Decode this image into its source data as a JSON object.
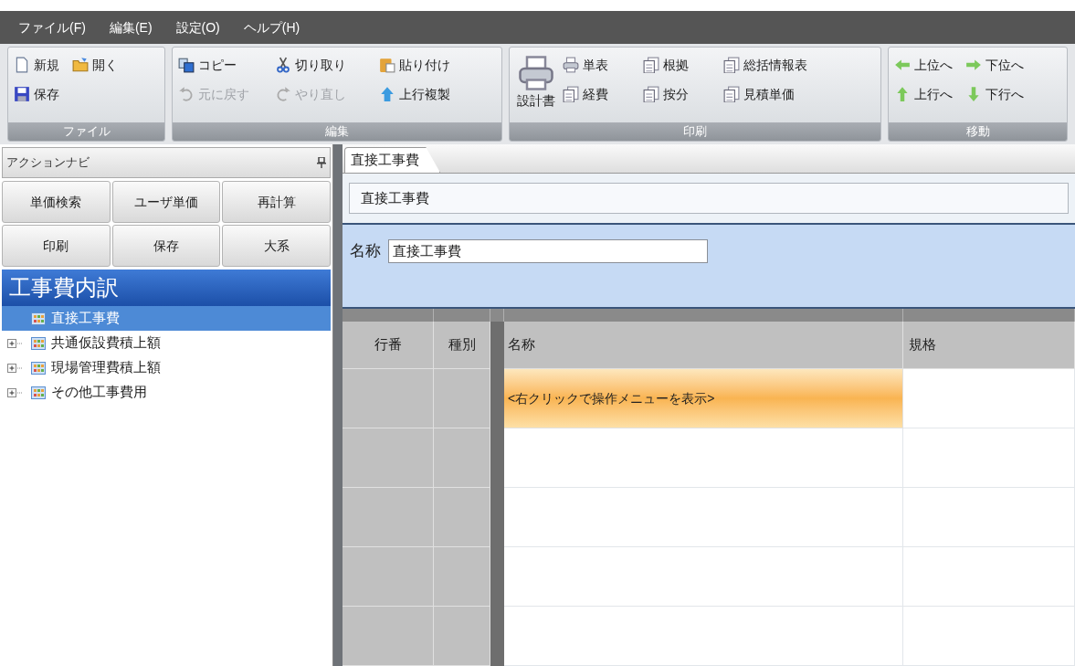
{
  "menu": [
    {
      "label": "ファイル(F)"
    },
    {
      "label": "編集(E)"
    },
    {
      "label": "設定(O)"
    },
    {
      "label": "ヘルプ(H)"
    }
  ],
  "ribbon": {
    "groups": [
      {
        "label": "ファイル",
        "rows": [
          [
            {
              "label": "新規",
              "disabled": false
            },
            {
              "label": "開く",
              "disabled": false
            }
          ],
          [
            {
              "label": "保存",
              "disabled": false
            }
          ]
        ]
      },
      {
        "label": "編集",
        "rows": [
          [
            {
              "label": "コピー",
              "disabled": false
            },
            {
              "label": "切り取り",
              "disabled": false
            },
            {
              "label": "貼り付け",
              "disabled": false
            }
          ],
          [
            {
              "label": "元に戻す",
              "disabled": true
            },
            {
              "label": "やり直し",
              "disabled": true
            },
            {
              "label": "上行複製",
              "disabled": false
            }
          ]
        ]
      },
      {
        "label": "印刷",
        "large_button": {
          "label": "設計書"
        },
        "rows": [
          [
            {
              "label": "単表",
              "disabled": false
            },
            {
              "label": "根拠",
              "disabled": false
            },
            {
              "label": "総括情報表",
              "disabled": false
            }
          ],
          [
            {
              "label": "経費",
              "disabled": false
            },
            {
              "label": "按分",
              "disabled": false
            },
            {
              "label": "見積単価",
              "disabled": false
            }
          ]
        ]
      },
      {
        "label": "移動",
        "rows": [
          [
            {
              "label": "上位へ",
              "disabled": false
            },
            {
              "label": "下位へ",
              "disabled": false
            }
          ],
          [
            {
              "label": "上行へ",
              "disabled": false
            },
            {
              "label": "下行へ",
              "disabled": false
            }
          ]
        ]
      }
    ]
  },
  "navi": {
    "title": "アクションナビ",
    "buttons": [
      {
        "label": "単価検索"
      },
      {
        "label": "ユーザ単価"
      },
      {
        "label": "再計算"
      },
      {
        "label": "印刷"
      },
      {
        "label": "保存"
      },
      {
        "label": "大系"
      }
    ],
    "tree_title": "工事費内訳",
    "tree": [
      {
        "label": "直接工事費",
        "kind": "leaf",
        "selected": true
      },
      {
        "label": "共通仮設費積上額",
        "kind": "collapsed",
        "selected": false
      },
      {
        "label": "現場管理費積上額",
        "kind": "collapsed",
        "selected": false
      },
      {
        "label": "その他工事費用",
        "kind": "collapsed",
        "selected": false
      }
    ]
  },
  "tabs": [
    {
      "label": "直接工事費",
      "selected": true
    }
  ],
  "path": "直接工事費",
  "name_field": {
    "label": "名称",
    "value": "直接工事費"
  },
  "grid": {
    "columns": [
      "行番",
      "種別",
      "名称",
      "規格"
    ],
    "rows": [
      {
        "selected": true,
        "hint": "<右クリックで操作メニューを表示>"
      },
      {
        "selected": false
      },
      {
        "selected": false
      },
      {
        "selected": false
      },
      {
        "selected": false
      }
    ]
  }
}
